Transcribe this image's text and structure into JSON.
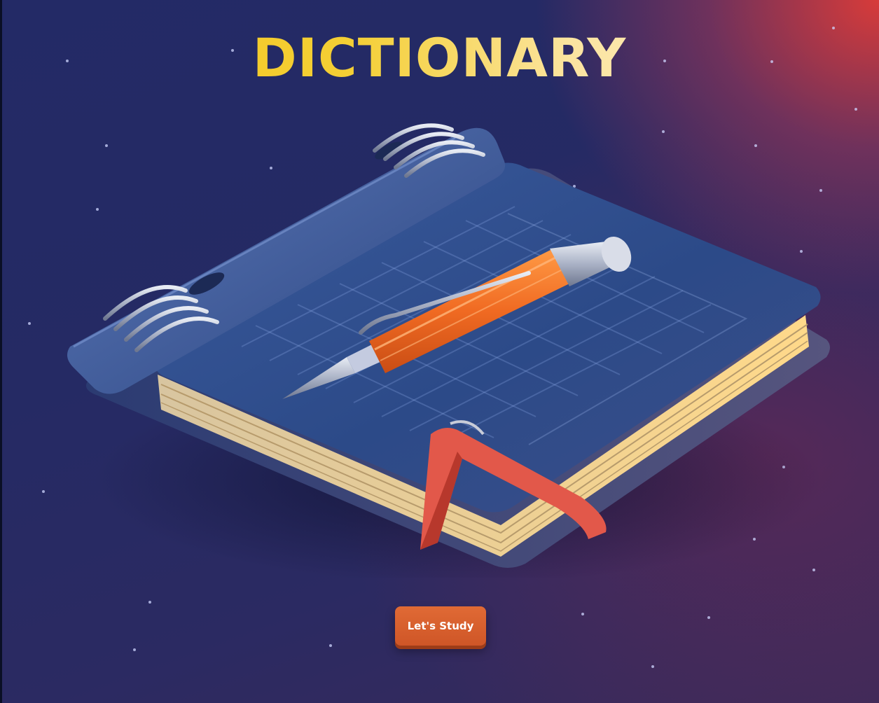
{
  "title": "DICTIONARY",
  "cta": {
    "label": "Let's Study"
  },
  "colors": {
    "background_primary": "#232a66",
    "background_accent": "#e13c37",
    "title_gold": "#f4c21e",
    "button_orange": "#d95e2d",
    "notebook_cover": "#2f4a86",
    "pencil_orange": "#f07a2c",
    "strap_red": "#e2584a"
  },
  "illustration": {
    "icon": "notebook-with-pencil-icon"
  }
}
